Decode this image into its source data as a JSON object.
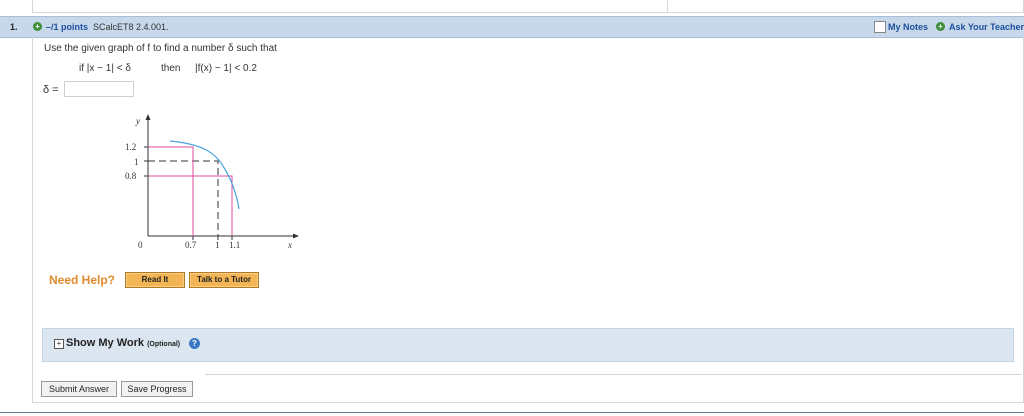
{
  "question_header": {
    "number": "1.",
    "plus_glyph": "+",
    "points": "–/1 points",
    "assignment_id": "SCalcET8 2.4.001.",
    "my_notes": "My Notes",
    "ask_teacher": "Ask Your Teacher"
  },
  "prompt": {
    "text": "Use the given graph of f to find a number δ such that",
    "condition_if": "if  |x − 1| < δ",
    "condition_then": "then",
    "condition_result": "|f(x) − 1| < 0.2"
  },
  "answer": {
    "label": "δ =",
    "value": ""
  },
  "graph": {
    "y_axis_label": "y",
    "x_axis_label": "x",
    "y_ticks": [
      "1.2",
      "1",
      "0.8"
    ],
    "x_ticks": [
      "0",
      "0.7",
      "1",
      "1.1"
    ],
    "colors": {
      "curve": "#4aa3df",
      "guides": "#e0489d",
      "dashed": "#333333"
    }
  },
  "help": {
    "label": "Need Help?",
    "read_it": "Read It",
    "talk_to_tutor": "Talk to a Tutor"
  },
  "show_work": {
    "toggle_glyph": "+",
    "title": "Show My Work",
    "optional": "(Optional)",
    "help_glyph": "?"
  },
  "actions": {
    "submit": "Submit Answer",
    "save": "Save Progress"
  }
}
